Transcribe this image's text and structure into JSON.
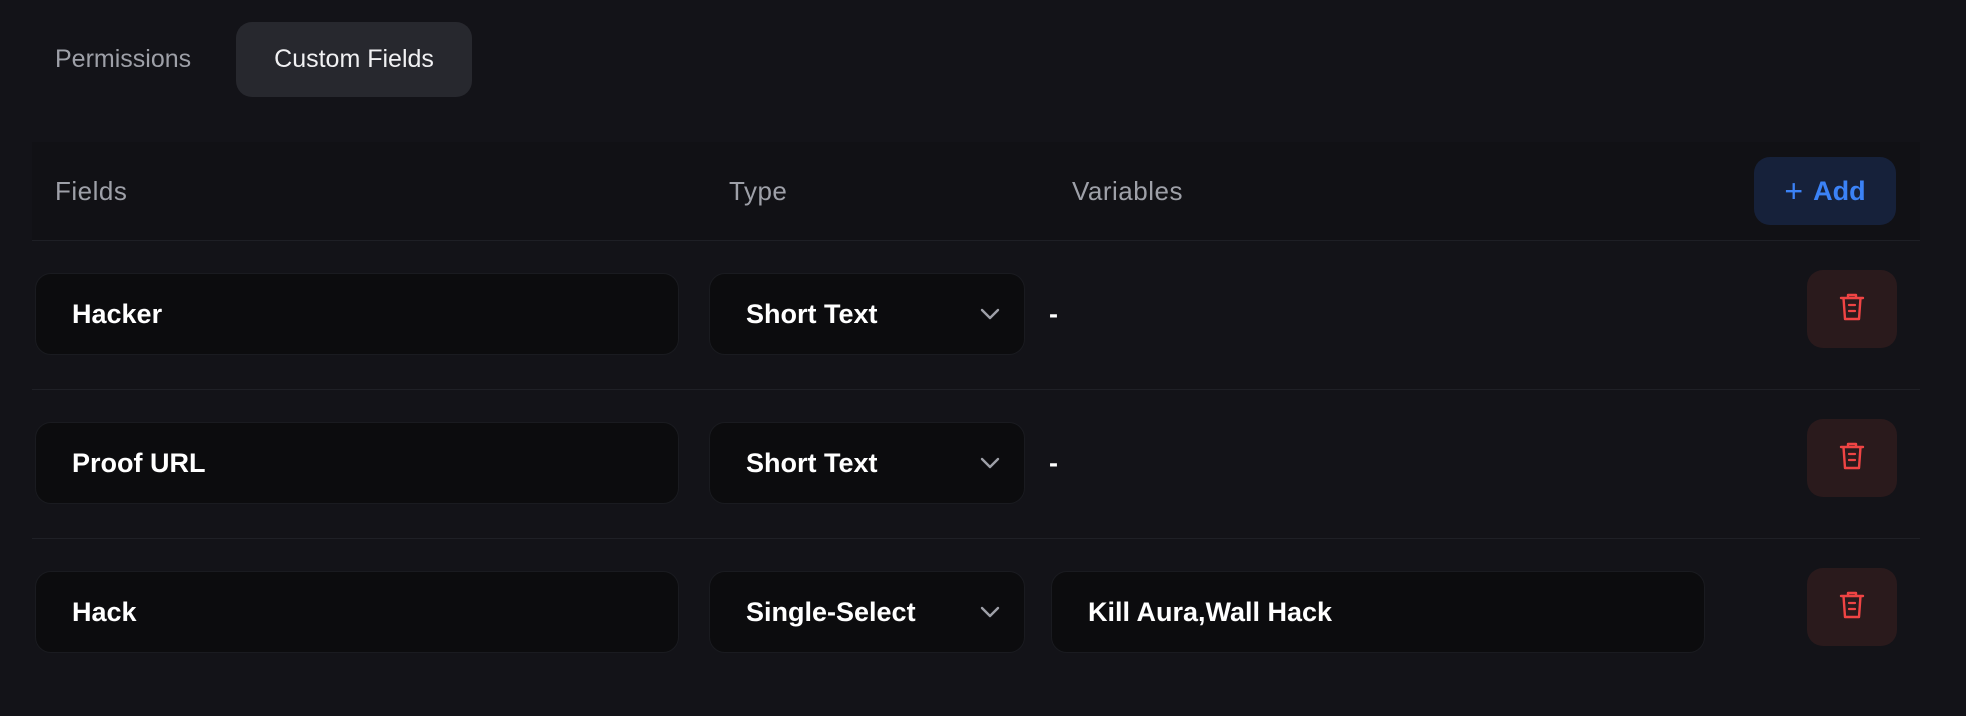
{
  "tabs": [
    {
      "label": "Permissions",
      "active": false
    },
    {
      "label": "Custom Fields",
      "active": true
    }
  ],
  "table": {
    "headers": {
      "fields": "Fields",
      "type": "Type",
      "variables": "Variables"
    },
    "add_button": {
      "icon": "plus-icon",
      "label": "Add"
    },
    "rows": [
      {
        "field": "Hacker",
        "type": "Short Text",
        "variables": "-"
      },
      {
        "field": "Proof URL",
        "type": "Short Text",
        "variables": "-"
      },
      {
        "field": "Hack",
        "type": "Single-Select",
        "variables": "Kill Aura,Wall Hack"
      }
    ],
    "delete_icon": "trash-icon"
  },
  "colors": {
    "background": "#131318",
    "accent_blue": "#3b82f6",
    "danger_red": "#ef4444",
    "tab_active_bg": "#27282e"
  }
}
